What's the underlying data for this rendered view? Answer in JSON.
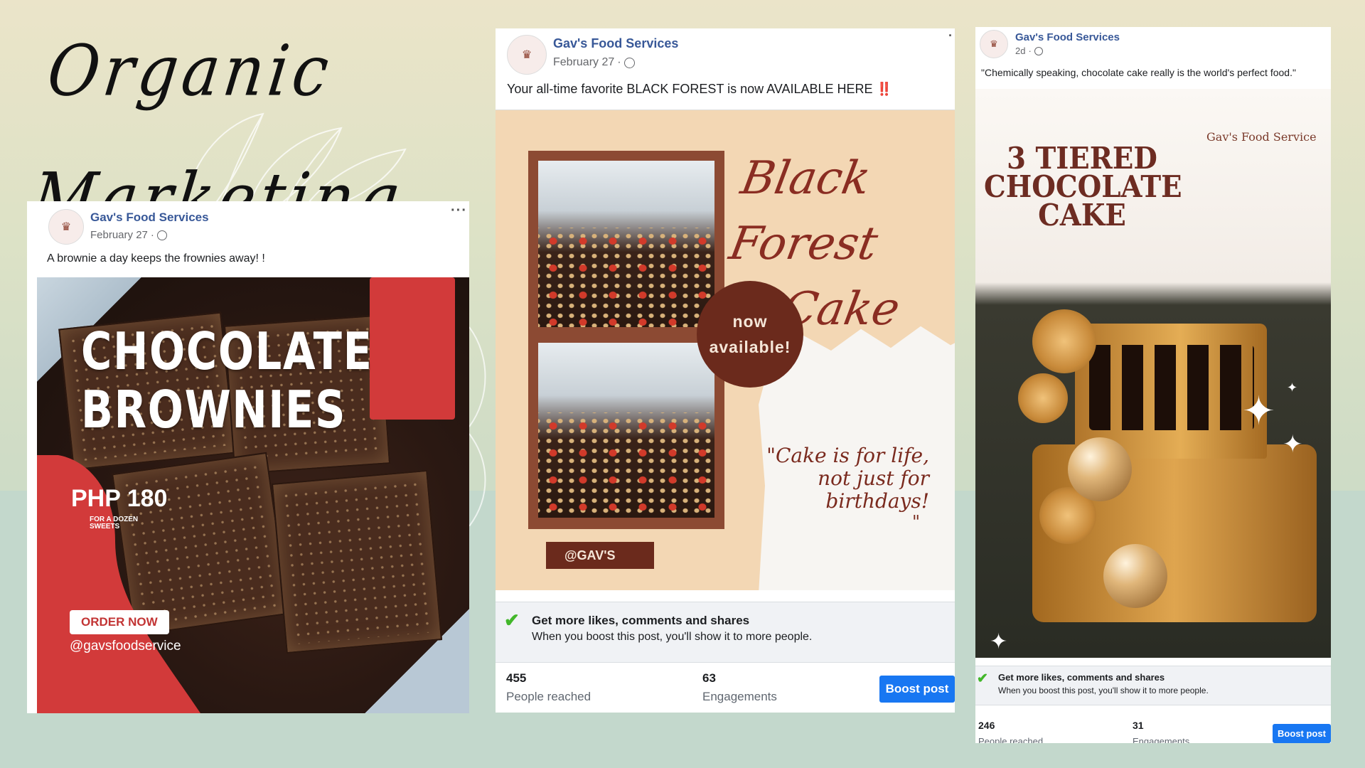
{
  "title": "Organic Marketing",
  "posts": [
    {
      "page_name": "Gav's Food Services",
      "date": "February 27",
      "caption": "A brownie a day keeps the frownies away! !",
      "image": {
        "title_line1": "CHOCOLATE",
        "title_line2": "BROWNIES",
        "price": "PHP 180",
        "price_sub": "FOR A DOZEN SWEETS",
        "cta": "ORDER NOW",
        "handle": "@gavsfoodservice"
      }
    },
    {
      "page_name": "Gav's Food Services",
      "date": "February 27",
      "caption": "Your all-time favorite BLACK FOREST is now AVAILABLE HERE",
      "caption_emoji": "‼️",
      "image": {
        "title_line1": "Black Forest",
        "title_line2": "Cake",
        "badge_line1": "now",
        "badge_line2": "available!",
        "quote": "\"Cake is for life, not just for birthdays!",
        "quote_end": "\"",
        "tag": "@GAV'S"
      },
      "boost": {
        "title": "Get more likes, comments and shares",
        "subtitle": "When you boost this post, you'll show it to more people."
      },
      "stats": [
        {
          "value": "455",
          "label": "People reached"
        },
        {
          "value": "63",
          "label": "Engagements"
        }
      ],
      "boost_button": "Boost post"
    },
    {
      "page_name": "Gav's Food Services",
      "date": "2d",
      "caption": "\"Chemically speaking, chocolate cake really is the world's perfect food.\"",
      "image": {
        "title_line1": "3 TIERED",
        "title_line2": "CHOCOLATE",
        "title_line3": "CAKE",
        "brand": "Gav's Food Service"
      },
      "boost": {
        "title": "Get more likes, comments and shares",
        "subtitle": "When you boost this post, you'll show it to more people."
      },
      "stats": [
        {
          "value": "246",
          "label": "People reached"
        },
        {
          "value": "31",
          "label": "Engagements"
        }
      ],
      "boost_button": "Boost post"
    }
  ],
  "icons": {
    "globe": "globe-icon",
    "more": "more-options-icon",
    "check": "checkmark-icon"
  },
  "colors": {
    "fb_link": "#385898",
    "boost_blue": "#1877f2",
    "brownie_red": "#d23a3a",
    "maroon": "#6b2a1c"
  }
}
